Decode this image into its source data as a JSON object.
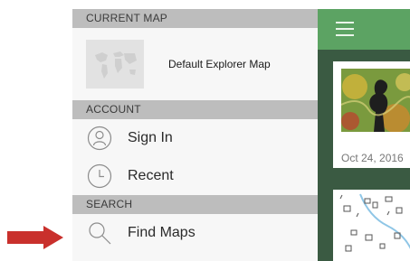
{
  "annotation": {
    "arrow_color": "#c9302c"
  },
  "drawer": {
    "current_map": {
      "header": "CURRENT MAP",
      "map_title": "Default Explorer Map",
      "thumb_icon": "world-map-icon"
    },
    "account": {
      "header": "ACCOUNT",
      "items": [
        {
          "label": "Sign In",
          "icon": "user-icon"
        },
        {
          "label": "Recent",
          "icon": "clock-icon"
        }
      ]
    },
    "search": {
      "header": "SEARCH",
      "items": [
        {
          "label": "Find Maps",
          "icon": "search-icon"
        }
      ]
    }
  },
  "content": {
    "accent_color": "#5ca363",
    "menu_icon": "hamburger-menu-icon",
    "cards": [
      {
        "date": "Oct 24, 2016"
      },
      {
        "date": ""
      }
    ]
  }
}
